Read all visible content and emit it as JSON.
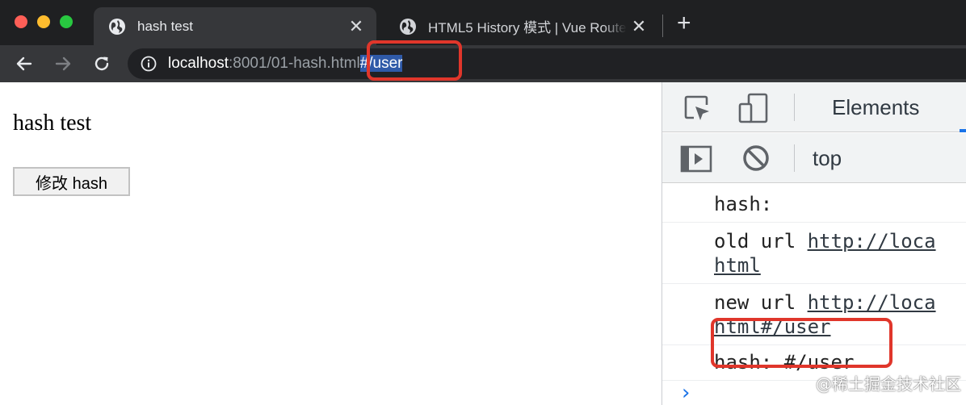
{
  "browser": {
    "tabs": [
      {
        "title": "hash test",
        "active": true,
        "icon": "globe-icon"
      },
      {
        "title": "HTML5 History 模式 | Vue Router",
        "active": false,
        "icon": "globe-icon"
      }
    ],
    "close_glyph": "✕",
    "new_tab_glyph": "+",
    "address": {
      "host": "localhost",
      "path": ":8001/01-hash.html",
      "hash": "#/user"
    }
  },
  "page": {
    "heading": "hash test",
    "button_label": "修改 hash"
  },
  "devtools": {
    "panel_tab": "Elements",
    "context": "top",
    "console": {
      "messages": [
        {
          "prefix": "hash:"
        },
        {
          "prefix": "old url ",
          "link": "http://loca",
          "link_cont": "html"
        },
        {
          "prefix": "new url ",
          "link": "http://loca",
          "link_cont": "html#/user"
        },
        {
          "prefix": "hash: #/user"
        }
      ],
      "prompt": "›"
    }
  },
  "watermark": "@稀土掘金技术社区",
  "colors": {
    "annotation": "#e0362b",
    "url_hash_highlight": "#2f5aa8",
    "devtools_accent": "#1a73e8"
  }
}
